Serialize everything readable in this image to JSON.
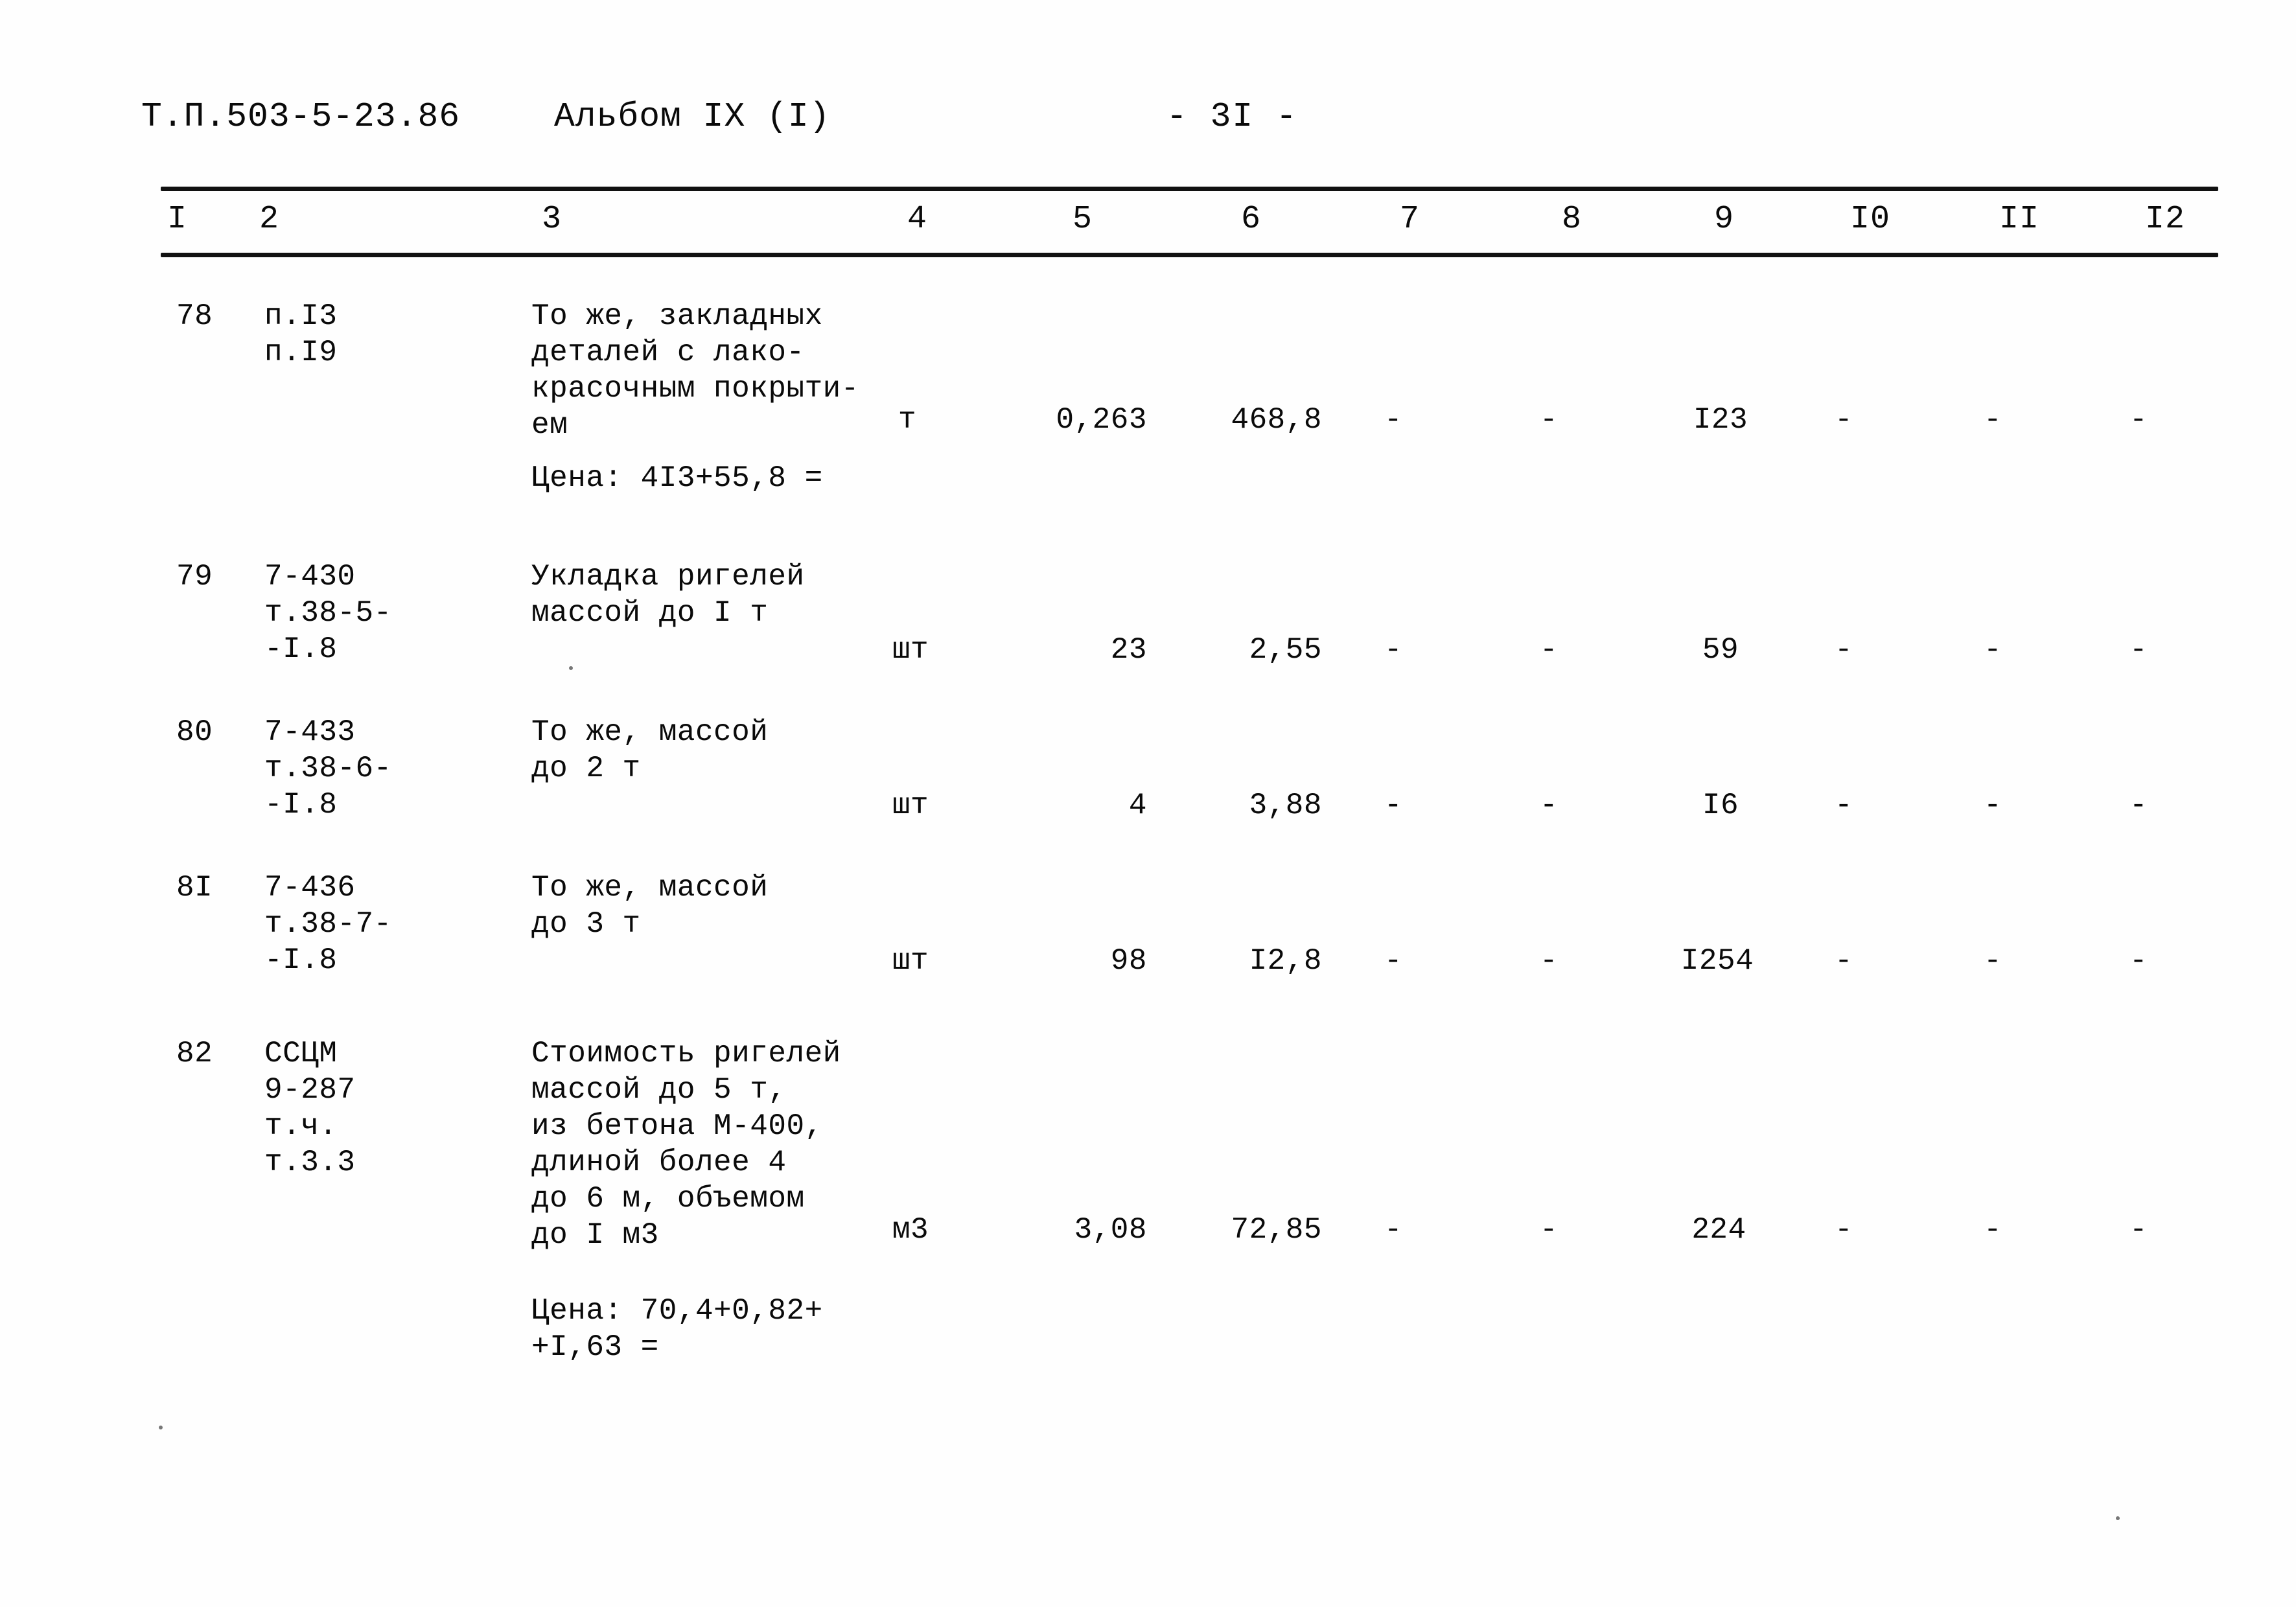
{
  "header": {
    "doc_code": "Т.П.503-5-23.86",
    "album": "Альбом IX (I)",
    "page_number": "- 3I -"
  },
  "table": {
    "column_headers": [
      "I",
      "2",
      "3",
      "4",
      "5",
      "6",
      "7",
      "8",
      "9",
      "I0",
      "II",
      "I2"
    ],
    "rows": [
      {
        "c1": "78",
        "c2": "п.I3\nп.I9",
        "c3": "То же, закладных\nдеталей с лако-\nкрасочным покрыти-\nем",
        "note": "Цена: 4I3+55,8 =",
        "c4": "т",
        "c5": "0,263",
        "c6": "468,8",
        "c7": "-",
        "c8": "-",
        "c9": "I23",
        "c10": "-",
        "c11": "-",
        "c12": "-"
      },
      {
        "c1": "79",
        "c2": "7-430\nт.38-5-\n-I.8",
        "c3": "Укладка ригелей\nмассой до I т",
        "note": "",
        "c4": "шт",
        "c5": "23",
        "c6": "2,55",
        "c7": "-",
        "c8": "-",
        "c9": "59",
        "c10": "-",
        "c11": "-",
        "c12": "-"
      },
      {
        "c1": "80",
        "c2": "7-433\nт.38-6-\n-I.8",
        "c3": "То же, массой\nдо 2 т",
        "note": "",
        "c4": "шт",
        "c5": "4",
        "c6": "3,88",
        "c7": "-",
        "c8": "-",
        "c9": "I6",
        "c10": "-",
        "c11": "-",
        "c12": "-"
      },
      {
        "c1": "8I",
        "c2": "7-436\nт.38-7-\n-I.8",
        "c3": "То же, массой\nдо 3 т",
        "note": "",
        "c4": "шт",
        "c5": "98",
        "c6": "I2,8",
        "c7": "-",
        "c8": "-",
        "c9": "I254",
        "c10": "-",
        "c11": "-",
        "c12": "-"
      },
      {
        "c1": "82",
        "c2": "ССЦМ\n9-287\nт.ч.\nт.3.3",
        "c3": "Стоимость ригелей\nмассой до 5 т,\nиз бетона М-400,\nдлиной более 4\nдо 6 м, объемом\nдо I м3",
        "note": "Цена: 70,4+0,82+\n+I,63 =",
        "c4": "м3",
        "c5": "3,08",
        "c6": "72,85",
        "c7": "-",
        "c8": "-",
        "c9": "224",
        "c10": "-",
        "c11": "-",
        "c12": "-"
      }
    ]
  }
}
